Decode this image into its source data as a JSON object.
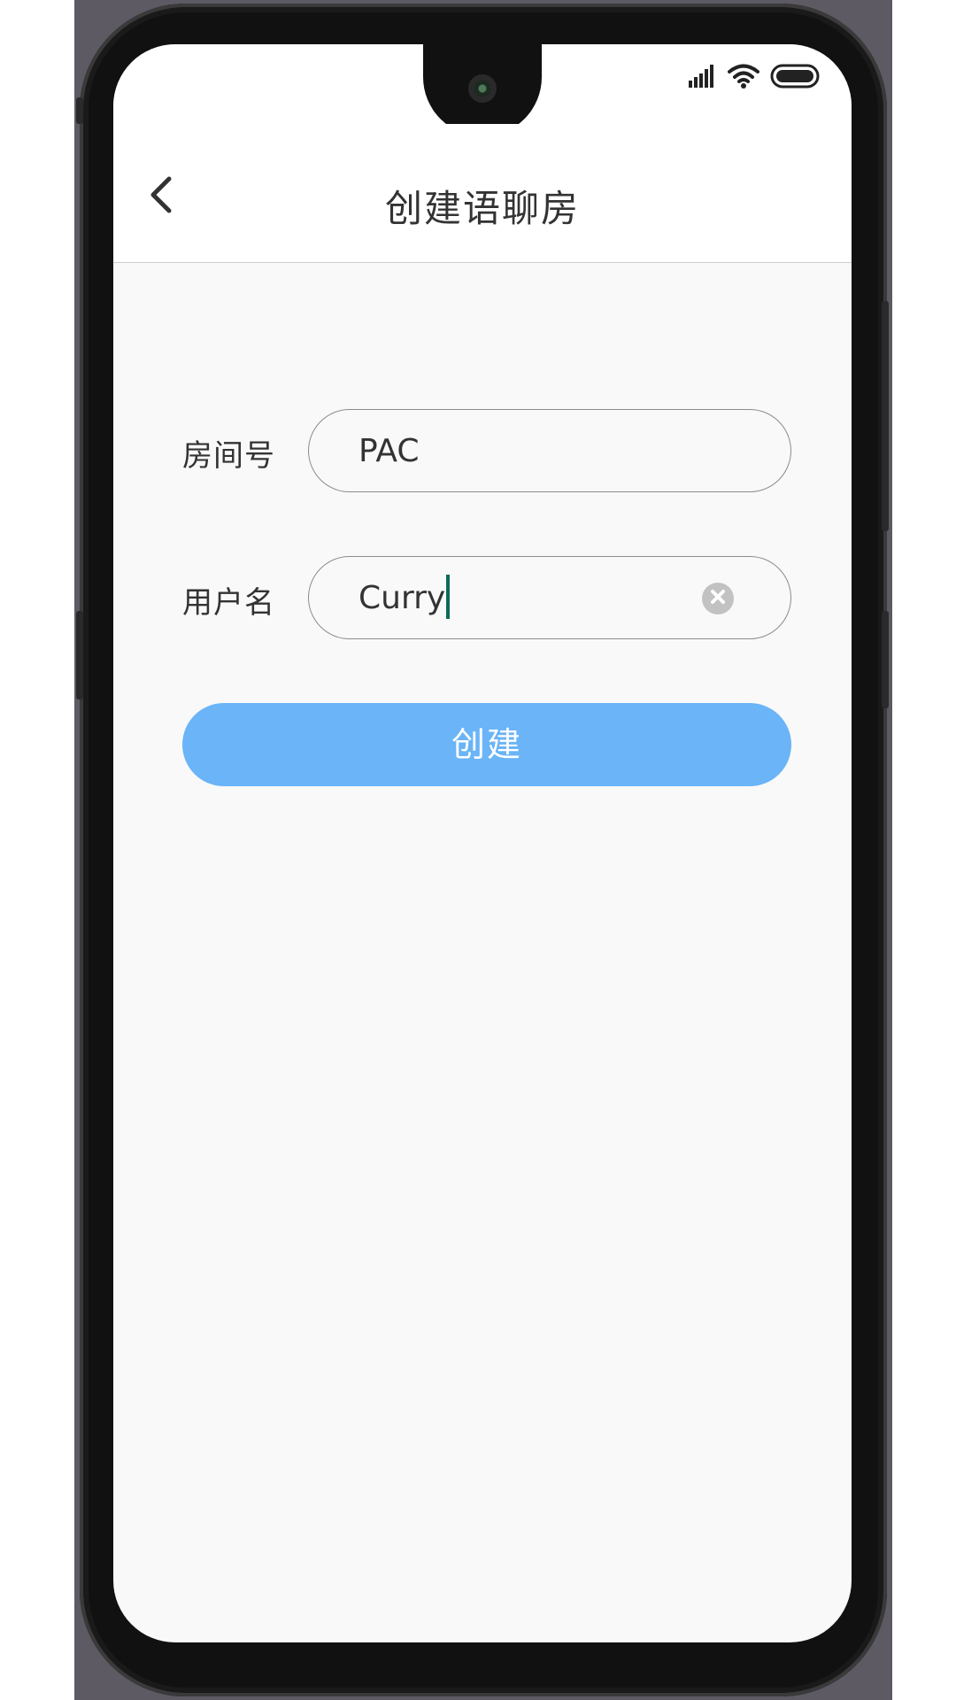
{
  "app_bar": {
    "title": "创建语聊房",
    "back_icon": "chevron-left-icon"
  },
  "status_bar": {
    "icons": [
      "signal-icon",
      "wifi-icon",
      "battery-icon"
    ]
  },
  "form": {
    "room_label": "房间号",
    "room_value": "PAC",
    "user_label": "用户名",
    "user_value": "Curry",
    "clear_icon": "clear-icon"
  },
  "actions": {
    "create_label": "创建"
  },
  "colors": {
    "primary_button": "#6ab4f7",
    "caret": "#0b6b5a",
    "screen_background": "#f9f9f9"
  }
}
